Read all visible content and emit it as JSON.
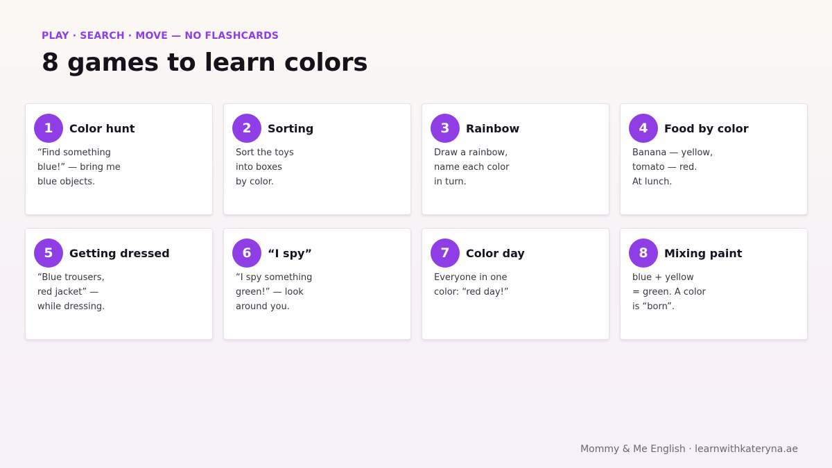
{
  "header": {
    "eyebrow": "PLAY · SEARCH · MOVE — NO FLASHCARDS",
    "title": "8 games to learn colors"
  },
  "cards": [
    {
      "number": "1",
      "title": "Color hunt",
      "lines": [
        "“Find something",
        "blue!” — bring me",
        "blue objects."
      ]
    },
    {
      "number": "2",
      "title": "Sorting",
      "lines": [
        "Sort the toys",
        "into boxes",
        "by color."
      ]
    },
    {
      "number": "3",
      "title": "Rainbow",
      "lines": [
        "Draw a rainbow,",
        "name each color",
        "in turn."
      ]
    },
    {
      "number": "4",
      "title": "Food by color",
      "lines": [
        "Banana — yellow,",
        "tomato — red.",
        "At lunch."
      ]
    },
    {
      "number": "5",
      "title": "Getting dressed",
      "lines": [
        "“Blue trousers,",
        "red jacket” —",
        "while dressing."
      ]
    },
    {
      "number": "6",
      "title": "“I spy”",
      "lines": [
        "“I spy something",
        "green!” — look",
        "around you."
      ]
    },
    {
      "number": "7",
      "title": "Color day",
      "lines": [
        "Everyone in one",
        "color: “red day!”"
      ]
    },
    {
      "number": "8",
      "title": "Mixing paint",
      "lines": [
        "blue + yellow",
        "= green. A color",
        "is “born”."
      ]
    }
  ],
  "footer": {
    "text": "Mommy & Me English · learnwithkateryna.ae"
  },
  "colors": {
    "accent": "#8f3ee6",
    "title": "#16121c",
    "muted": "#6b6672"
  }
}
